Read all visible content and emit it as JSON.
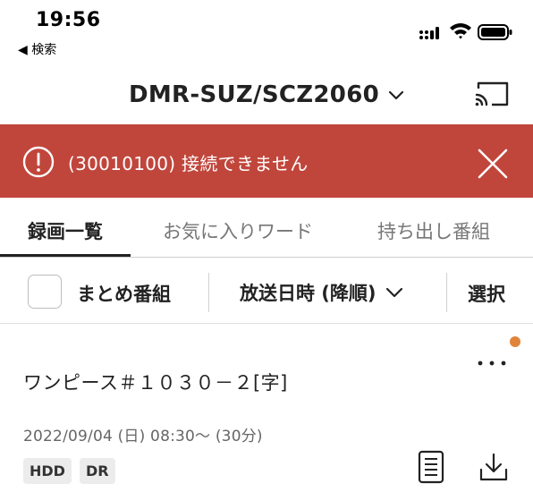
{
  "status_bar": {
    "time": "19:56",
    "back_label": "◀ 検索"
  },
  "header": {
    "device_title": "DMR-SUZ/SCZ2060"
  },
  "error_banner": {
    "message": "(30010100) 接続できません",
    "color": "#c0463c"
  },
  "tabs": [
    {
      "label": "録画一覧",
      "active": true
    },
    {
      "label": "お気に入りワード",
      "active": false
    },
    {
      "label": "持ち出し番組",
      "active": false
    }
  ],
  "filter_bar": {
    "matome_label": "まとめ番組",
    "matome_checked": false,
    "sort_label": "放送日時 (降順)",
    "select_label": "選択"
  },
  "recordings": [
    {
      "title": "ワンピース＃１０３０－２[字]",
      "datetime": "2022/09/04 (日) 08:30～ (30分)",
      "badges": [
        "HDD",
        "DR"
      ],
      "unread_dot_color": "#e0843a"
    }
  ]
}
